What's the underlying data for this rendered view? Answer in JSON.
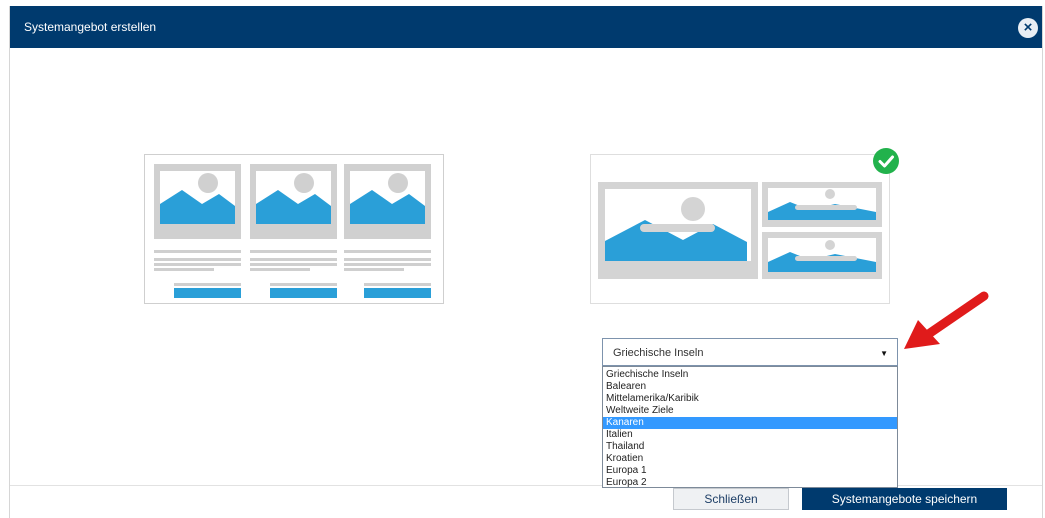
{
  "dialog": {
    "title": "Systemangebot erstellen",
    "close_icon": "close-icon"
  },
  "dropdown": {
    "selected": "Griechische Inseln",
    "options": [
      "Griechische Inseln",
      "Balearen",
      "Mittelamerika/Karibik",
      "Weltweite Ziele",
      "Kanaren",
      "Italien",
      "Thailand",
      "Kroatien",
      "Europa 1",
      "Europa 2"
    ],
    "highlighted_option": "Kanaren"
  },
  "footer": {
    "close_label": "Schließen",
    "save_label": "Systemangebote speichern"
  },
  "colors": {
    "header": "#003a6e",
    "accent_blue": "#2a9fd8",
    "check_green": "#22b24c",
    "arrow_red": "#e01b1b",
    "highlight": "#3399ff"
  }
}
